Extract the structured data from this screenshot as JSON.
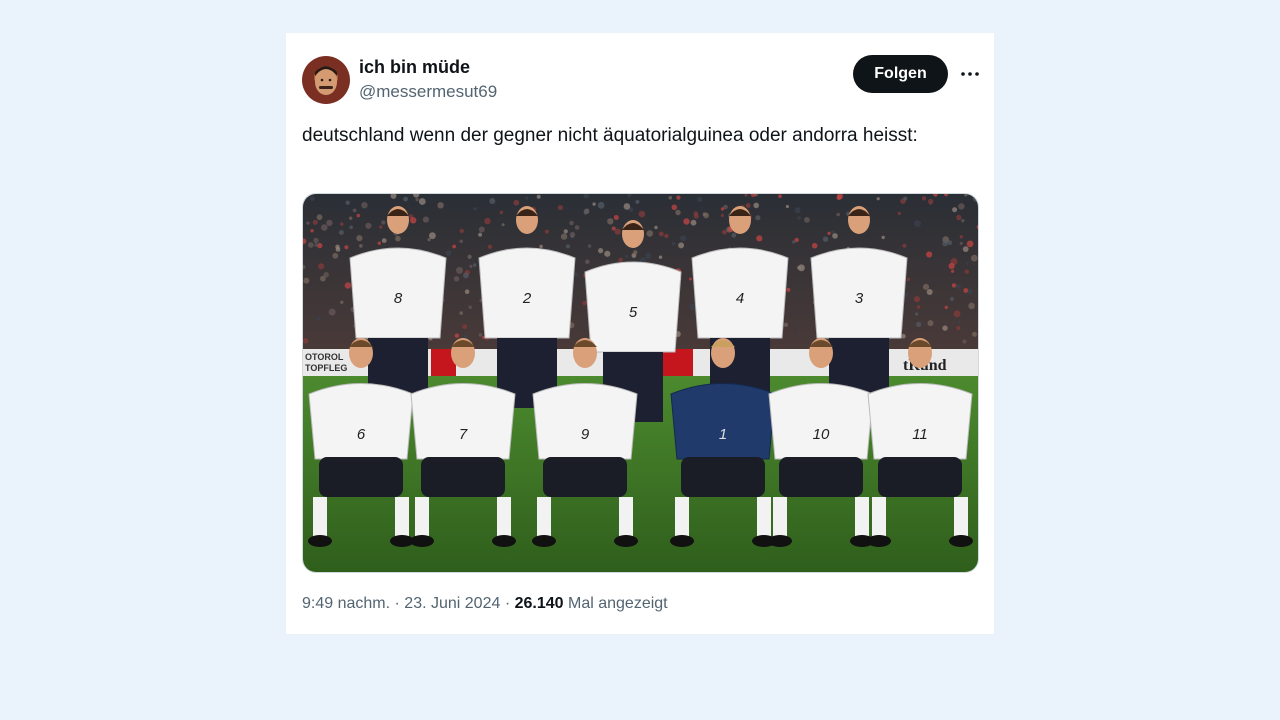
{
  "tweet": {
    "author_name": "ich bin müde",
    "author_handle": "@messermesut69",
    "follow_label": "Folgen",
    "more_label": "···",
    "text": "deutschland wenn der gegner nicht äquatorialguinea oder andorra heisst:",
    "time": "9:49 nachm.",
    "date": "23. Juni 2024",
    "views_count": "26.140",
    "views_label": "Mal angezeigt",
    "separator": "·"
  },
  "photo": {
    "banner_left": "OTOROL\nTOPFLEG",
    "banner_right": "tRund",
    "back_row_numbers": [
      "8",
      "2",
      "5",
      "4",
      "3"
    ],
    "front_row_numbers": [
      "6",
      "7",
      "9",
      "1",
      "10",
      "11"
    ]
  }
}
